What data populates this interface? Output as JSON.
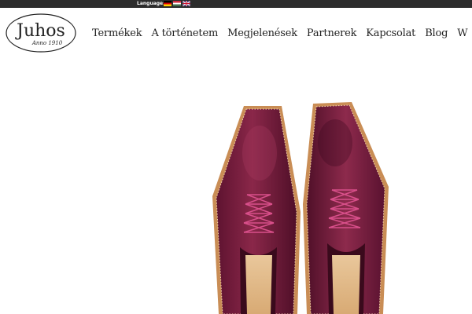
{
  "topbar": {
    "language_label": "Language:",
    "flags": [
      "german-flag-icon",
      "hungarian-flag-icon",
      "uk-flag-icon"
    ]
  },
  "logo": {
    "name": "Juhos",
    "tagline": "Anno 1910"
  },
  "nav": {
    "items": [
      "Termékek",
      "A történetem",
      "Megjelenések",
      "Partnerek",
      "Kapcsolat",
      "Blog",
      "W"
    ]
  },
  "colors": {
    "topbar": "#2c2c2c",
    "text": "#222222",
    "shoe_leather": "#7a1f3d"
  }
}
